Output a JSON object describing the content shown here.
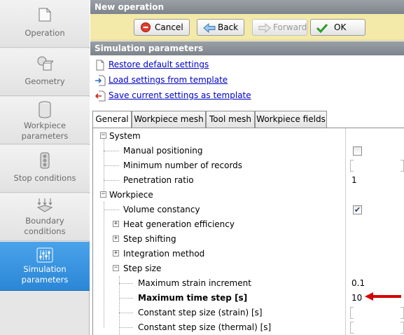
{
  "sidebar": {
    "items": [
      {
        "label": "Operation",
        "icon": "document-icon",
        "active": false
      },
      {
        "label": "Geometry",
        "icon": "geometry-icon",
        "active": false
      },
      {
        "label": "Workpiece\nparameters",
        "icon": "cylinder-icon",
        "active": false
      },
      {
        "label": "Stop conditions",
        "icon": "traffic-light-icon",
        "active": false
      },
      {
        "label": "Boundary\nconditions",
        "icon": "boundary-arrows-icon",
        "active": false
      },
      {
        "label": "Simulation\nparameters",
        "icon": "sliders-icon",
        "active": true
      }
    ]
  },
  "header": {
    "title": "New operation"
  },
  "toolbar": {
    "cancel_label": "Cancel",
    "back_label": "Back",
    "forward_label": "Forward",
    "ok_label": "OK"
  },
  "section": {
    "title": "Simulation parameters"
  },
  "links": {
    "restore": "Restore default settings",
    "load": "Load settings from template",
    "save": "Save current settings as template"
  },
  "tabs": [
    "General",
    "Workpiece mesh",
    "Tool mesh",
    "Workpiece fields"
  ],
  "grid": {
    "system": "System",
    "manual_positioning": "Manual positioning",
    "min_records": "Minimum number of records",
    "penetration_ratio": "Penetration ratio",
    "penetration_ratio_value": "1",
    "workpiece": "Workpiece",
    "volume_constancy": "Volume constancy",
    "heat_generation": "Heat generation efficiency",
    "step_shifting": "Step shifting",
    "integration_method": "Integration method",
    "step_size": "Step size",
    "max_strain_increment": "Maximum strain increment",
    "max_strain_increment_value": "0.1",
    "max_time_step": "Maximum time step [s]",
    "max_time_step_value": "10",
    "const_step_strain": "Constant step size (strain) [s]",
    "const_step_thermal": "Constant step size (thermal) [s]"
  },
  "colors": {
    "active_sidebar": "#2b86d6",
    "toolbar_bg": "#f3e9a8",
    "annotation_arrow": "#d40000"
  }
}
